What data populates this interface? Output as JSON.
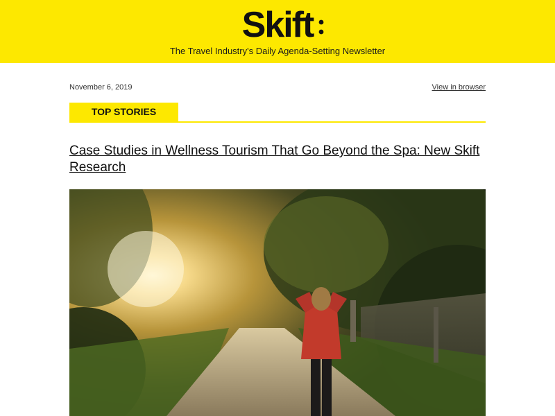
{
  "header": {
    "logo_text": "Skift",
    "tagline": "The Travel Industry's Daily Agenda-Setting Newsletter",
    "background_color": "#fde800"
  },
  "meta": {
    "date": "November 6, 2019",
    "view_in_browser": "View in browser"
  },
  "section": {
    "label": "TOP STORIES"
  },
  "story": {
    "headline": "Case Studies in Wellness Tourism That Go Beyond the Spa: New Skift Research",
    "image_icon": "woman-walking-sunlit-path-photo"
  }
}
